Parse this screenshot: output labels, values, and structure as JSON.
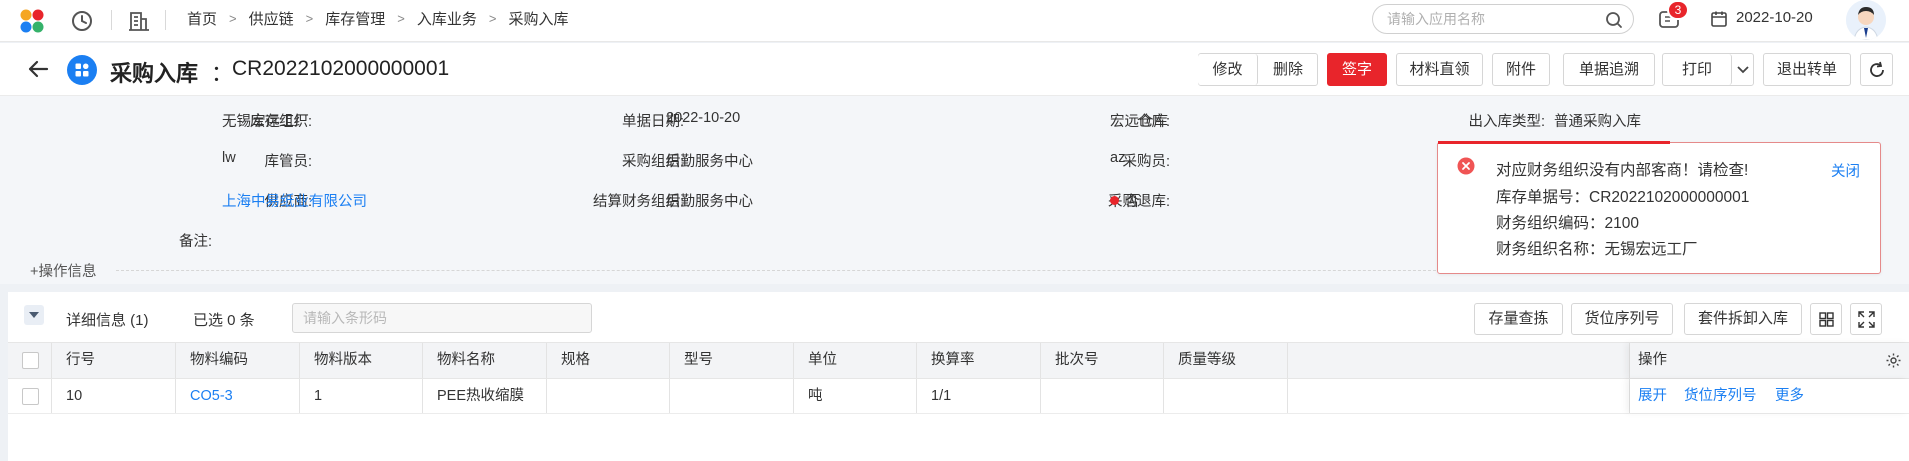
{
  "topbar": {
    "breadcrumbs": [
      "首页",
      "供应链",
      "库存管理",
      "入库业务",
      "采购入库"
    ],
    "search_placeholder": "请输入应用名称",
    "message_count": "3",
    "date": "2022-10-20"
  },
  "header": {
    "title": "采购入库",
    "colon": "：",
    "doc_number": "CR2022102000000001",
    "buttons": {
      "edit": "修改",
      "delete": "删除",
      "sign": "签字",
      "material_direct": "材料直领",
      "attachment": "附件",
      "trace": "单据追溯",
      "print": "打印",
      "exit_transfer": "退出转单"
    }
  },
  "form": {
    "inventory_org_label": "库存组织:",
    "inventory_org_value": "无锡宏远工厂",
    "doc_date_label": "单据日期:",
    "doc_date_value": "2022-10-20",
    "warehouse_label": "仓库:",
    "warehouse_value": "宏远仓库",
    "io_type_label": "出入库类型:",
    "io_type_value": "普通采购入库",
    "keeper_label": "库管员:",
    "keeper_value": "lw",
    "purchase_org_label": "采购组织:",
    "purchase_org_value": "后勤服务中心",
    "buyer_label": "采购员:",
    "buyer_value": "az",
    "supplier_label": "供应商:",
    "supplier_value": "上海中易纸业有限公司",
    "settle_org_label": "结算财务组织:",
    "settle_org_value": "后勤服务中心",
    "return_label": "采购退库:",
    "return_value": "否",
    "remark_label": "备注:",
    "op_info": "+操作信息"
  },
  "alert": {
    "message": "对应财务组织没有内部客商！请检查!",
    "doc_line": "库存单据号：CR2022102000000001",
    "code_line": "财务组织编码：2100",
    "name_line": "财务组织名称：无锡宏远工厂",
    "close": "关闭",
    "accent_color": "#e8252b"
  },
  "grid": {
    "detail_label": "详细信息 (1)",
    "selected_label": "已选 0 条",
    "barcode_placeholder": "请输入条形码",
    "buttons": {
      "stock_check": "存量查拣",
      "location_serial": "货位序列号",
      "kit_split": "套件拆卸入库"
    },
    "columns": [
      "行号",
      "物料编码",
      "物料版本",
      "物料名称",
      "规格",
      "型号",
      "单位",
      "换算率",
      "批次号",
      "质量等级",
      "操作"
    ],
    "rows": [
      {
        "line_no": "10",
        "material_code": "CO5-3",
        "version": "1",
        "name": "PEE热收缩膜",
        "spec": "",
        "model": "",
        "unit": "吨",
        "rate": "1/1",
        "batch": "",
        "quality": "",
        "actions": [
          "展开",
          "货位序列号",
          "更多"
        ]
      }
    ]
  },
  "colors": {
    "brand_blue": "#1b7ff2",
    "danger_red": "#e8252b"
  }
}
